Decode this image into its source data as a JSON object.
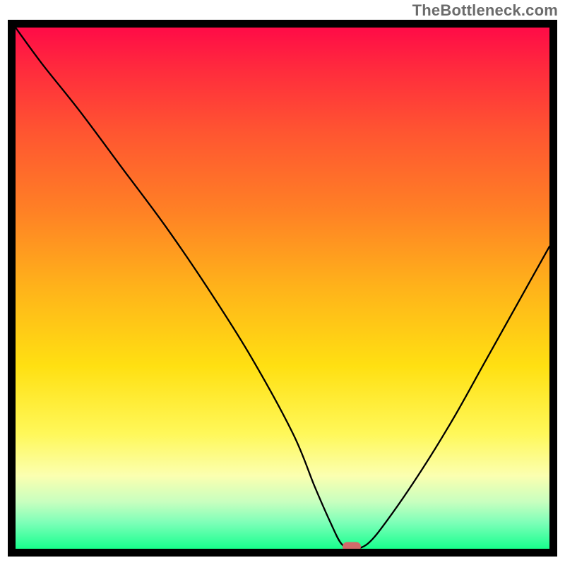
{
  "watermark": "TheBottleneck.com",
  "chart_data": {
    "type": "line",
    "title": "",
    "xlabel": "",
    "ylabel": "",
    "xlim": [
      0,
      100
    ],
    "ylim": [
      0,
      100
    ],
    "grid": false,
    "series": [
      {
        "name": "bottleneck-curve",
        "x": [
          0,
          5,
          12,
          20,
          28,
          36,
          44,
          52,
          56,
          59,
          61,
          63,
          66,
          70,
          76,
          82,
          88,
          94,
          100
        ],
        "y": [
          100,
          93,
          84,
          73,
          62,
          50,
          37,
          22,
          12,
          5,
          1,
          0,
          1,
          6,
          15,
          25,
          36,
          47,
          58
        ]
      }
    ],
    "annotations": [
      {
        "name": "optimal-marker",
        "x": 63,
        "y": 0
      }
    ],
    "background_gradient_stops": [
      {
        "pos": 0,
        "color": "#ff0b47"
      },
      {
        "pos": 8,
        "color": "#ff2b3d"
      },
      {
        "pos": 20,
        "color": "#ff5531"
      },
      {
        "pos": 35,
        "color": "#ff8025"
      },
      {
        "pos": 50,
        "color": "#ffb31a"
      },
      {
        "pos": 65,
        "color": "#ffe012"
      },
      {
        "pos": 78,
        "color": "#fff85a"
      },
      {
        "pos": 86,
        "color": "#fbffb0"
      },
      {
        "pos": 91,
        "color": "#c8ffbf"
      },
      {
        "pos": 95,
        "color": "#7dffb8"
      },
      {
        "pos": 99,
        "color": "#2cff97"
      },
      {
        "pos": 100,
        "color": "#18ff8b"
      }
    ]
  }
}
